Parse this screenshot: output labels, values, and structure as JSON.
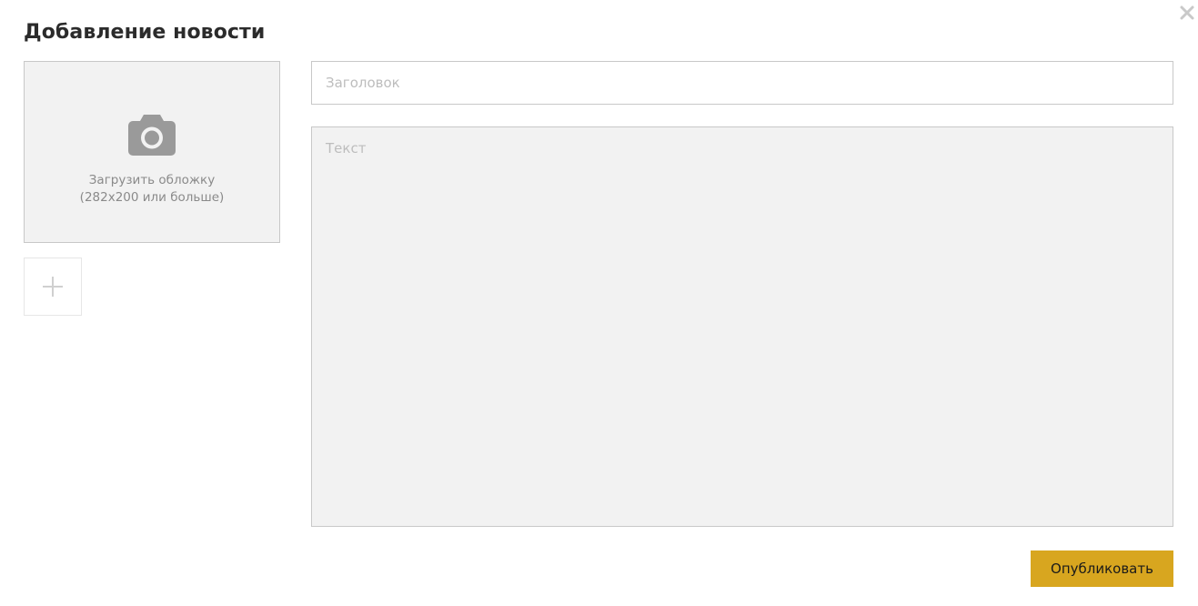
{
  "modal": {
    "title": "Добавление новости",
    "close_icon": "close-icon"
  },
  "cover": {
    "icon": "camera-icon",
    "label_line1": "Загрузить обложку",
    "label_line2": "(282x200 или больше)"
  },
  "gallery": {
    "add_icon": "plus-icon"
  },
  "form": {
    "title_placeholder": "Заголовок",
    "title_value": "",
    "text_placeholder": "Текст",
    "text_value": ""
  },
  "actions": {
    "publish_label": "Опубликовать"
  },
  "colors": {
    "accent": "#d8a61f",
    "icon_gray": "#9a9a9a",
    "field_gray": "#f2f2f2",
    "border": "#c8c8c8"
  }
}
